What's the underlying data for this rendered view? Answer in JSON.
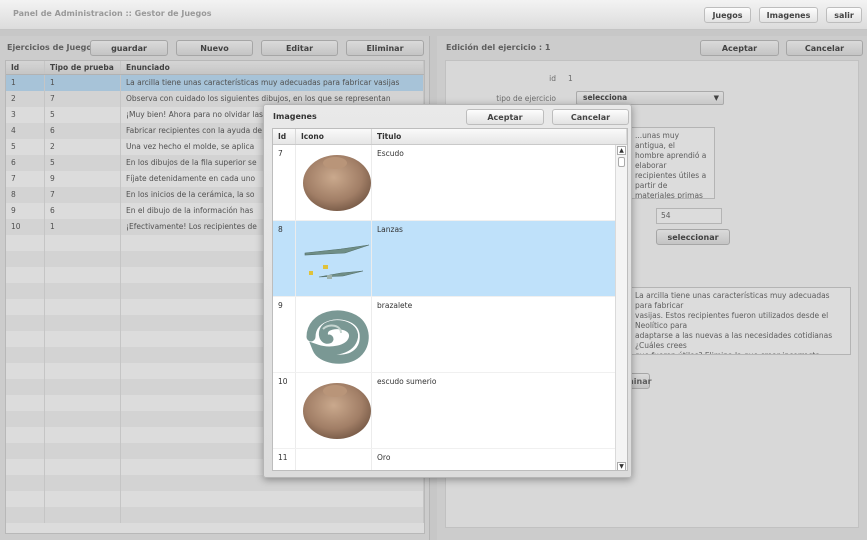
{
  "app": {
    "title": "Panel de Administracion :: Gestor de Juegos"
  },
  "topnav": {
    "juegos": "Juegos",
    "imagenes": "Imagenes",
    "salir": "salir"
  },
  "left": {
    "title": "Ejercicios de Juego :",
    "buttons": {
      "guardar": "guardar",
      "nuevo": "Nuevo",
      "editar": "Editar",
      "eliminar": "Eliminar"
    },
    "columns": [
      "Id",
      "Tipo de prueba",
      "Enunciado"
    ],
    "rows": [
      [
        "1",
        "1",
        "La arcilla tiene unas características muy adecuadas para fabricar vasijas"
      ],
      [
        "2",
        "7",
        "Observa con cuidado los siguientes dibujos, en los que se representan"
      ],
      [
        "3",
        "5",
        "¡Muy bien! Ahora para no olvidar las técnicas este tipo de cerámica"
      ],
      [
        "4",
        "6",
        "Fabricar recipientes con la ayuda de"
      ],
      [
        "5",
        "2",
        "Una vez hecho el molde, se aplica"
      ],
      [
        "6",
        "5",
        "En los dibujos de la fila superior se"
      ],
      [
        "7",
        "9",
        "Fíjate detenidamente en cada uno"
      ],
      [
        "8",
        "7",
        "En los inicios de la cerámica, la so"
      ],
      [
        "9",
        "6",
        "En el dibujo de la información has"
      ],
      [
        "10",
        "1",
        "¡Efectivamente! Los recipientes de"
      ]
    ],
    "selected_id": "1"
  },
  "right": {
    "title": "Edición del ejercicio : 1",
    "buttons": {
      "aceptar": "Aceptar",
      "cancelar": "Cancelar"
    },
    "labels": {
      "id": "id",
      "tipo": "tipo de ejercicio"
    },
    "id_value": "1",
    "combo_value": "selecciona",
    "text1": "...unas muy antigua, el\nhombre aprendió a elaborar\nrecipientes útiles a partir de\nmateriales primas que tenía\na su alcance. La cerámica es\nun proceso",
    "number_value": "54",
    "select_button": "seleccionar",
    "text2": "La arcilla tiene unas características muy adecuadas para fabricar\nvasijas. Estos recipientes fueron utilizados desde el Neolítico para\nadaptarse a las nuevas a las necesidades cotidianas ¿Cuáles crees\nque fueron útiles? Elimina la que crear incorrecta",
    "small_button": "Eliminar"
  },
  "dialog": {
    "title": "Imagenes",
    "aceptar": "Aceptar",
    "cancelar": "Cancelar",
    "columns": [
      "Id",
      "Icono",
      "Titulo"
    ],
    "rows": [
      {
        "id": "7",
        "titulo": "Escudo",
        "icon": "shield-artifact"
      },
      {
        "id": "8",
        "titulo": "Lanzas",
        "icon": "spears-artifact"
      },
      {
        "id": "9",
        "titulo": "brazalete",
        "icon": "bracelet-artifact"
      },
      {
        "id": "10",
        "titulo": "escudo sumerio",
        "icon": "shield-artifact"
      },
      {
        "id": "11",
        "titulo": "Oro",
        "icon": "gold-artifact"
      }
    ],
    "selected_id": "8"
  }
}
